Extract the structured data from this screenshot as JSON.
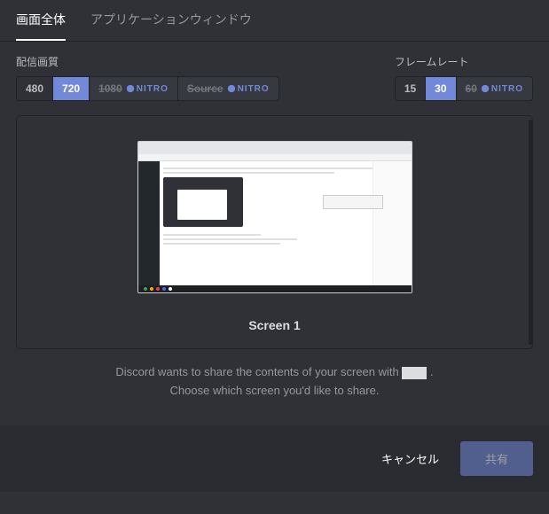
{
  "tabs": {
    "entire_screen": "画面全体",
    "app_window": "アプリケーションウィンドウ"
  },
  "quality": {
    "label": "配信画質",
    "options": [
      "480",
      "720"
    ],
    "nitro_options": [
      "1080",
      "Source"
    ],
    "selected": "720",
    "nitro_badge": "NITRO"
  },
  "framerate": {
    "label": "フレームレート",
    "options": [
      "15",
      "30"
    ],
    "nitro_options": [
      "60"
    ],
    "selected": "30",
    "nitro_badge": "NITRO"
  },
  "preview": {
    "screen_label": "Screen 1"
  },
  "share_prompt": {
    "line1_prefix": "Discord wants to share the contents of your screen with ",
    "line2": "Choose which screen you'd like to share."
  },
  "footer": {
    "cancel": "キャンセル",
    "share": "共有"
  }
}
